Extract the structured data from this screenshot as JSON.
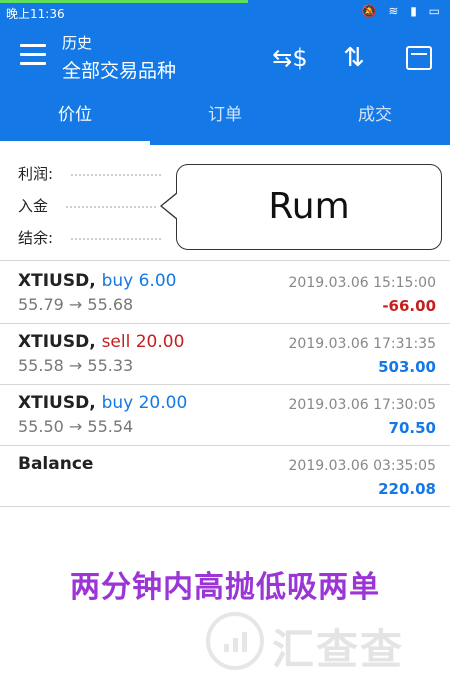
{
  "status_bar": {
    "time": "晚上11:36",
    "icons": [
      "mute-icon",
      "wifi-icon",
      "signal-icon",
      "battery-icon"
    ]
  },
  "app_bar": {
    "title": "历史",
    "subtitle": "全部交易品种",
    "actions": [
      "currency-exchange-icon",
      "sort-arrows-icon",
      "calendar-icon"
    ]
  },
  "tabs": [
    {
      "label": "价位",
      "active": true
    },
    {
      "label": "订单",
      "active": false
    },
    {
      "label": "成交",
      "active": false
    }
  ],
  "summary": {
    "profit_label": "利润:",
    "deposit_label": "入金",
    "balance_label": "结余:"
  },
  "overlay": {
    "bubble_text": "Rum",
    "caption": "两分钟内高抛低吸两单"
  },
  "trades": [
    {
      "symbol": "XTIUSD,",
      "direction": "buy 6.00",
      "type": "buy",
      "prices": "55.79 → 55.68",
      "datetime": "2019.03.06 15:15:00",
      "profit": "-66.00"
    },
    {
      "symbol": "XTIUSD,",
      "direction": "sell 20.00",
      "type": "sell",
      "prices": "55.58 → 55.33",
      "datetime": "2019.03.06 17:31:35",
      "profit": "503.00"
    },
    {
      "symbol": "XTIUSD,",
      "direction": "buy 20.00",
      "type": "buy",
      "prices": "55.50 → 55.54",
      "datetime": "2019.03.06 17:30:05",
      "profit": "70.50"
    },
    {
      "symbol": "Balance",
      "direction": "",
      "type": "",
      "prices": "",
      "datetime": "2019.03.06 03:35:05",
      "profit": "220.08"
    }
  ],
  "watermark": {
    "text": "汇查查"
  },
  "colors": {
    "primary": "#1479e6",
    "loss": "#c51f1f",
    "caption": "#9b35d6"
  }
}
